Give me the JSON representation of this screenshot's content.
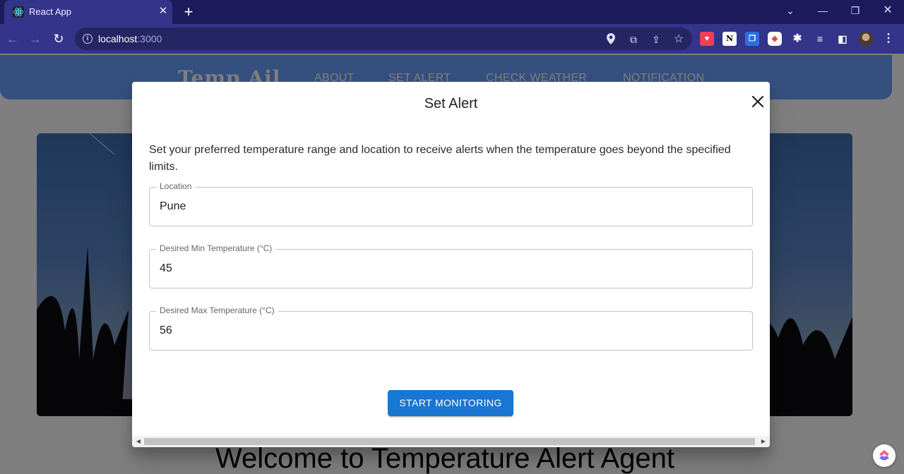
{
  "browser": {
    "tab_title": "React App",
    "url_host": "localhost",
    "url_port": ":3000"
  },
  "navbar": {
    "brand": "Temp Ail",
    "links": [
      "ABOUT",
      "SET ALERT",
      "CHECK WEATHER",
      "NOTIFICATION"
    ]
  },
  "page": {
    "welcome": "Welcome to Temperature Alert Agent"
  },
  "dialog": {
    "title": "Set Alert",
    "description": "Set your preferred temperature range and location to receive alerts when the temperature goes beyond the specified limits.",
    "fields": [
      {
        "label": "Location",
        "value": "Pune"
      },
      {
        "label": "Desired Min Temperature (°C)",
        "value": "45"
      },
      {
        "label": "Desired Max Temperature (°C)",
        "value": "56"
      }
    ],
    "submit_label": "START MONITORING"
  },
  "colors": {
    "browser_frame": "#1e1b5c",
    "toolbar": "#34348a",
    "navbar": "#6aa0ff",
    "primary_button": "#1976d2"
  },
  "icons": [
    "react-favicon",
    "close-icon",
    "plus-icon",
    "chevron-down-icon",
    "minimize-icon",
    "restore-icon",
    "back-arrow-icon",
    "forward-arrow-icon",
    "reload-icon",
    "info-icon",
    "location-pin-icon",
    "open-external-icon",
    "share-icon",
    "star-icon",
    "extensions-puzzle-icon",
    "sidebar-icon",
    "avatar",
    "kebab-menu-icon",
    "clickup-icon"
  ]
}
